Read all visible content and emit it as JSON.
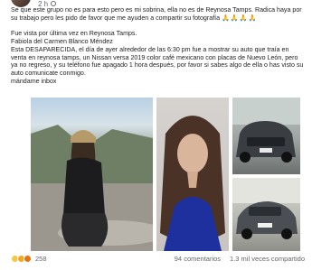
{
  "post": {
    "time": "2 h",
    "lines": [
      "Se que este grupo no es para esto pero es mi sobrina, ella no es de Reynosa Tamps. Radica haya por su trabajo pero les pido de favor que me ayuden a compartir su fotografía",
      "Fue vista por última vez en Reynosa Tamps.",
      "Fabiola del Carmen Blanco Méndez",
      "Esta DESAPARECIDA, el día de ayer alrededor de las 6:30 pm fue a mostrar su auto que traía en venta en reynosa tamps, un Nissan versa 2019 color café mexicano con placas de Nuevo León, pero ya no regreso, y su teléfono fue apagado 1 hora después, por favor si sabes algo de ella o has visto su auto comunicate conmigo.",
      "mándame inbox"
    ],
    "prayer_emojis": "🙏🙏🙏🙏"
  },
  "photos": [
    {
      "name": "woman-outdoors-photo"
    },
    {
      "name": "woman-portrait-photo"
    },
    {
      "name": "car-front-photo"
    },
    {
      "name": "car-side-photo"
    }
  ],
  "footer": {
    "reaction_count": "258",
    "comments": "94 comentarios",
    "shares": "1.3 mil veces compartido"
  }
}
